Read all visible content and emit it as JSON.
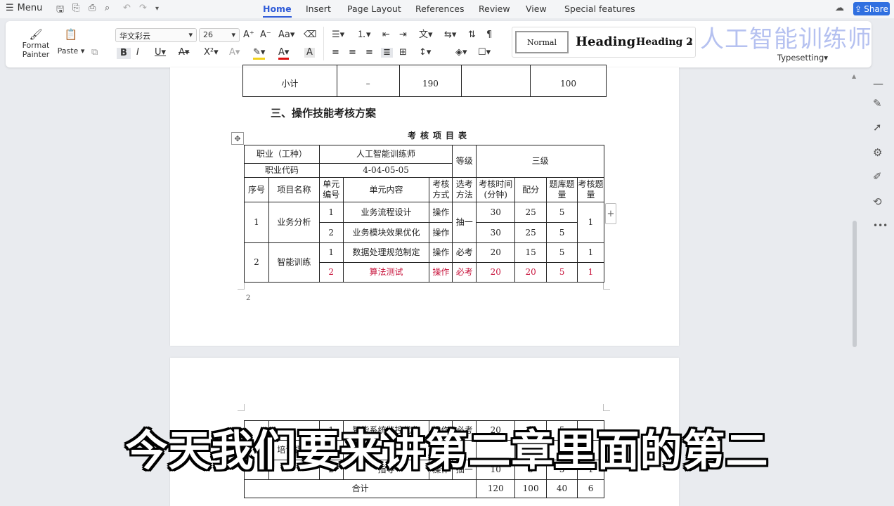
{
  "menubar": {
    "menu_label": "Menu",
    "tabs": [
      "Home",
      "Insert",
      "Page Layout",
      "References",
      "Review",
      "View",
      "Special features"
    ],
    "share_label": "Share"
  },
  "ribbon": {
    "format_painter": "Format Painter",
    "paste": "Paste",
    "font_name": "华文彩云",
    "font_size": "26",
    "style_normal": "Normal",
    "style_heading": "Heading",
    "style_heading2": "Heading 2",
    "typesetting": "Typesetting"
  },
  "watermark": "人工智能训练师",
  "page1": {
    "prev_table_row": [
      "小计",
      "–",
      "190",
      "",
      "100"
    ],
    "section_heading": "三、操作技能考核方案",
    "table_title": "考核项目表",
    "info": {
      "occupation_label": "职业（工种）",
      "occupation_value": "人工智能训练师",
      "level_label": "等级",
      "level_value": "三级",
      "code_label": "职业代码",
      "code_value": "4-04-05-05"
    },
    "headers": [
      "序号",
      "项目名称",
      "单元编号",
      "单元内容",
      "考核方式",
      "选考方法",
      "考核时间(分钟)",
      "配分",
      "题库题量",
      "考核题量"
    ],
    "groups": [
      {
        "index": "1",
        "name": "业务分析",
        "method_choice": "抽一",
        "exam_count": "1",
        "rows": [
          {
            "unit": "1",
            "content": "业务流程设计",
            "mode": "操作",
            "time": "30",
            "score": "25",
            "bank": "5"
          },
          {
            "unit": "2",
            "content": "业务模块效果优化",
            "mode": "操作",
            "time": "30",
            "score": "25",
            "bank": "5"
          }
        ]
      },
      {
        "index": "2",
        "name": "智能训练",
        "rows": [
          {
            "unit": "1",
            "content": "数据处理规范制定",
            "mode": "操作",
            "choice": "必考",
            "time": "20",
            "score": "15",
            "bank": "5",
            "count": "1"
          },
          {
            "unit": "2",
            "content": "算法测试",
            "mode": "操作",
            "choice": "必考",
            "time": "20",
            "score": "20",
            "bank": "5",
            "count": "1"
          }
        ]
      }
    ],
    "page_number": "2"
  },
  "page2": {
    "row_a": {
      "unit": "1",
      "content": "智能系统监控优化",
      "mode": "操作",
      "choice": "必考",
      "time": "20",
      "score": "15",
      "bank": "5"
    },
    "row_b": {
      "group": "培训指导",
      "unit": "2",
      "content": "指导",
      "mode": "操作",
      "choice": "抽一",
      "time": "10",
      "score": "5",
      "bank": "5",
      "count": "1"
    },
    "total": {
      "label": "合计",
      "time": "120",
      "score": "100",
      "bank": "40",
      "count": "6"
    }
  },
  "subtitle": "今天我们要来讲第二章里面的第二",
  "colors": {
    "accent": "#2f5bd8",
    "red_row": "#c8143c",
    "watermark": "#a9b7ee"
  }
}
